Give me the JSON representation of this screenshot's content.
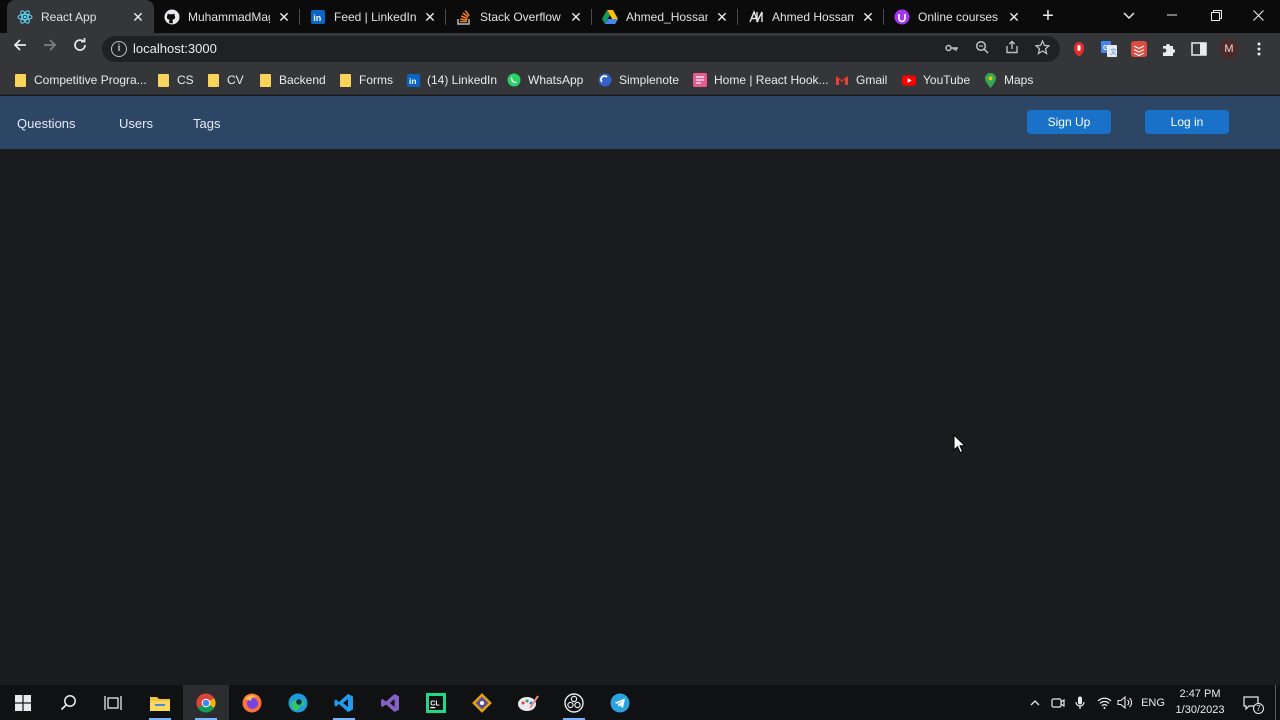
{
  "browser": {
    "tabs": [
      {
        "title": "React App",
        "icon": "react-icon",
        "active": true
      },
      {
        "title": "MuhammadMag",
        "icon": "github-icon",
        "active": false
      },
      {
        "title": "Feed | LinkedIn",
        "icon": "linkedin-icon",
        "active": false
      },
      {
        "title": "Stack Overflow C",
        "icon": "stackoverflow-icon",
        "active": false
      },
      {
        "title": "Ahmed_Hossam_",
        "icon": "google-drive-icon",
        "active": false
      },
      {
        "title": "Ahmed Hossam",
        "icon": "atcoder-icon",
        "active": false
      },
      {
        "title": "Online courses -",
        "icon": "udemy-icon",
        "active": false
      }
    ],
    "tab_close_glyph": "✕",
    "new_tab_glyph": "+",
    "url": "localhost:3000",
    "profile_initial": "M",
    "bookmarks": [
      {
        "label": "Competitive Progra...",
        "icon": "folder-icon"
      },
      {
        "label": "CS",
        "icon": "folder-icon"
      },
      {
        "label": "CV",
        "icon": "folder-icon"
      },
      {
        "label": "Backend",
        "icon": "folder-icon"
      },
      {
        "label": "Forms",
        "icon": "folder-icon"
      },
      {
        "label": "(14) LinkedIn",
        "icon": "linkedin-icon"
      },
      {
        "label": "WhatsApp",
        "icon": "whatsapp-icon"
      },
      {
        "label": "Simplenote",
        "icon": "simplenote-icon"
      },
      {
        "label": "Home | React Hook...",
        "icon": "react-hook-form-icon"
      },
      {
        "label": "Gmail",
        "icon": "gmail-icon"
      },
      {
        "label": "YouTube",
        "icon": "youtube-icon"
      },
      {
        "label": "Maps",
        "icon": "maps-icon"
      }
    ]
  },
  "app": {
    "nav": {
      "questions": "Questions",
      "users": "Users",
      "tags": "Tags"
    },
    "auth": {
      "signup": "Sign Up",
      "login": "Log in"
    },
    "colors": {
      "navbar": "#2e4666",
      "button": "#1a72c8",
      "background": "#1b1c1f"
    }
  },
  "taskbar": {
    "apps": [
      {
        "name": "file-explorer-icon"
      },
      {
        "name": "chrome-icon"
      },
      {
        "name": "firefox-icon"
      },
      {
        "name": "edge-icon"
      },
      {
        "name": "vscode-icon"
      },
      {
        "name": "visual-studio-icon"
      },
      {
        "name": "clion-icon"
      },
      {
        "name": "git-icon"
      },
      {
        "name": "paint-icon"
      },
      {
        "name": "obs-icon"
      },
      {
        "name": "telegram-icon"
      }
    ],
    "language": "ENG",
    "time": "2:47 PM",
    "date": "1/30/2023",
    "notifications": "7"
  }
}
